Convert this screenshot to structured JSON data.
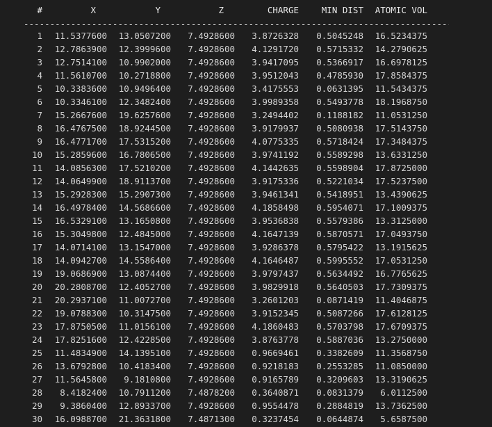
{
  "table": {
    "headers": [
      "#",
      "X",
      "Y",
      "Z",
      "CHARGE",
      "MIN DIST",
      "ATOMIC VOL"
    ],
    "divider": "----------------------------------------------------------------------------------------------",
    "rows": [
      [
        "1",
        "11.5377600",
        "13.0507200",
        "7.4928600",
        "3.8726328",
        "0.5045248",
        "16.5234375"
      ],
      [
        "2",
        "12.7863900",
        "12.3999600",
        "7.4928600",
        "4.1291720",
        "0.5715332",
        "14.2790625"
      ],
      [
        "3",
        "12.7514100",
        "10.9902000",
        "7.4928600",
        "3.9417095",
        "0.5366917",
        "16.6978125"
      ],
      [
        "4",
        "11.5610700",
        "10.2718800",
        "7.4928600",
        "3.9512043",
        "0.4785930",
        "17.8584375"
      ],
      [
        "5",
        "10.3383600",
        "10.9496400",
        "7.4928600",
        "3.4175553",
        "0.0631395",
        "11.5434375"
      ],
      [
        "6",
        "10.3346100",
        "12.3482400",
        "7.4928600",
        "3.9989358",
        "0.5493778",
        "18.1968750"
      ],
      [
        "7",
        "15.2667600",
        "19.6257600",
        "7.4928600",
        "3.2494402",
        "0.1188182",
        "11.0531250"
      ],
      [
        "8",
        "16.4767500",
        "18.9244500",
        "7.4928600",
        "3.9179937",
        "0.5080938",
        "17.5143750"
      ],
      [
        "9",
        "16.4771700",
        "17.5315200",
        "7.4928600",
        "4.0775335",
        "0.5718424",
        "17.3484375"
      ],
      [
        "10",
        "15.2859600",
        "16.7806500",
        "7.4928600",
        "3.9741192",
        "0.5589298",
        "13.6331250"
      ],
      [
        "11",
        "14.0856300",
        "17.5210200",
        "7.4928600",
        "4.1442635",
        "0.5598904",
        "17.8725000"
      ],
      [
        "12",
        "14.0649900",
        "18.9113700",
        "7.4928600",
        "3.9175336",
        "0.5221034",
        "17.5237500"
      ],
      [
        "13",
        "15.2928300",
        "15.2907300",
        "7.4928600",
        "3.9461341",
        "0.5418951",
        "13.4390625"
      ],
      [
        "14",
        "16.4978400",
        "14.5686600",
        "7.4928600",
        "4.1858498",
        "0.5954071",
        "17.1009375"
      ],
      [
        "15",
        "16.5329100",
        "13.1650800",
        "7.4928600",
        "3.9536838",
        "0.5579386",
        "13.3125000"
      ],
      [
        "16",
        "15.3049800",
        "12.4845000",
        "7.4928600",
        "4.1647139",
        "0.5870571",
        "17.0493750"
      ],
      [
        "17",
        "14.0714100",
        "13.1547000",
        "7.4928600",
        "3.9286378",
        "0.5795422",
        "13.1915625"
      ],
      [
        "18",
        "14.0942700",
        "14.5586400",
        "7.4928600",
        "4.1646487",
        "0.5995552",
        "17.0531250"
      ],
      [
        "19",
        "19.0686900",
        "13.0874400",
        "7.4928600",
        "3.9797437",
        "0.5634492",
        "16.7765625"
      ],
      [
        "20",
        "20.2808700",
        "12.4052700",
        "7.4928600",
        "3.9829918",
        "0.5640503",
        "17.7309375"
      ],
      [
        "21",
        "20.2937100",
        "11.0072700",
        "7.4928600",
        "3.2601203",
        "0.0871419",
        "11.4046875"
      ],
      [
        "22",
        "19.0788300",
        "10.3147500",
        "7.4928600",
        "3.9152345",
        "0.5087266",
        "17.6128125"
      ],
      [
        "23",
        "17.8750500",
        "11.0156100",
        "7.4928600",
        "4.1860483",
        "0.5703798",
        "17.6709375"
      ],
      [
        "24",
        "17.8251600",
        "12.4228500",
        "7.4928600",
        "3.8763778",
        "0.5887036",
        "13.2750000"
      ],
      [
        "25",
        "11.4834900",
        "14.1395100",
        "7.4928600",
        "0.9669461",
        "0.3382609",
        "11.3568750"
      ],
      [
        "26",
        "13.6792800",
        "10.4183400",
        "7.4928600",
        "0.9218183",
        "0.2553285",
        "11.0850000"
      ],
      [
        "27",
        "11.5645800",
        "9.1810800",
        "7.4928600",
        "0.9165789",
        "0.3209603",
        "13.3190625"
      ],
      [
        "28",
        "8.4182400",
        "10.7911200",
        "7.4878200",
        "0.3640871",
        "0.0831379",
        "6.0112500"
      ],
      [
        "29",
        "9.3860400",
        "12.8933700",
        "7.4928600",
        "0.9554478",
        "0.2884819",
        "13.7362500"
      ],
      [
        "30",
        "16.0988700",
        "21.3631800",
        "7.4871300",
        "0.3237454",
        "0.0644874",
        "5.6587500"
      ]
    ]
  }
}
